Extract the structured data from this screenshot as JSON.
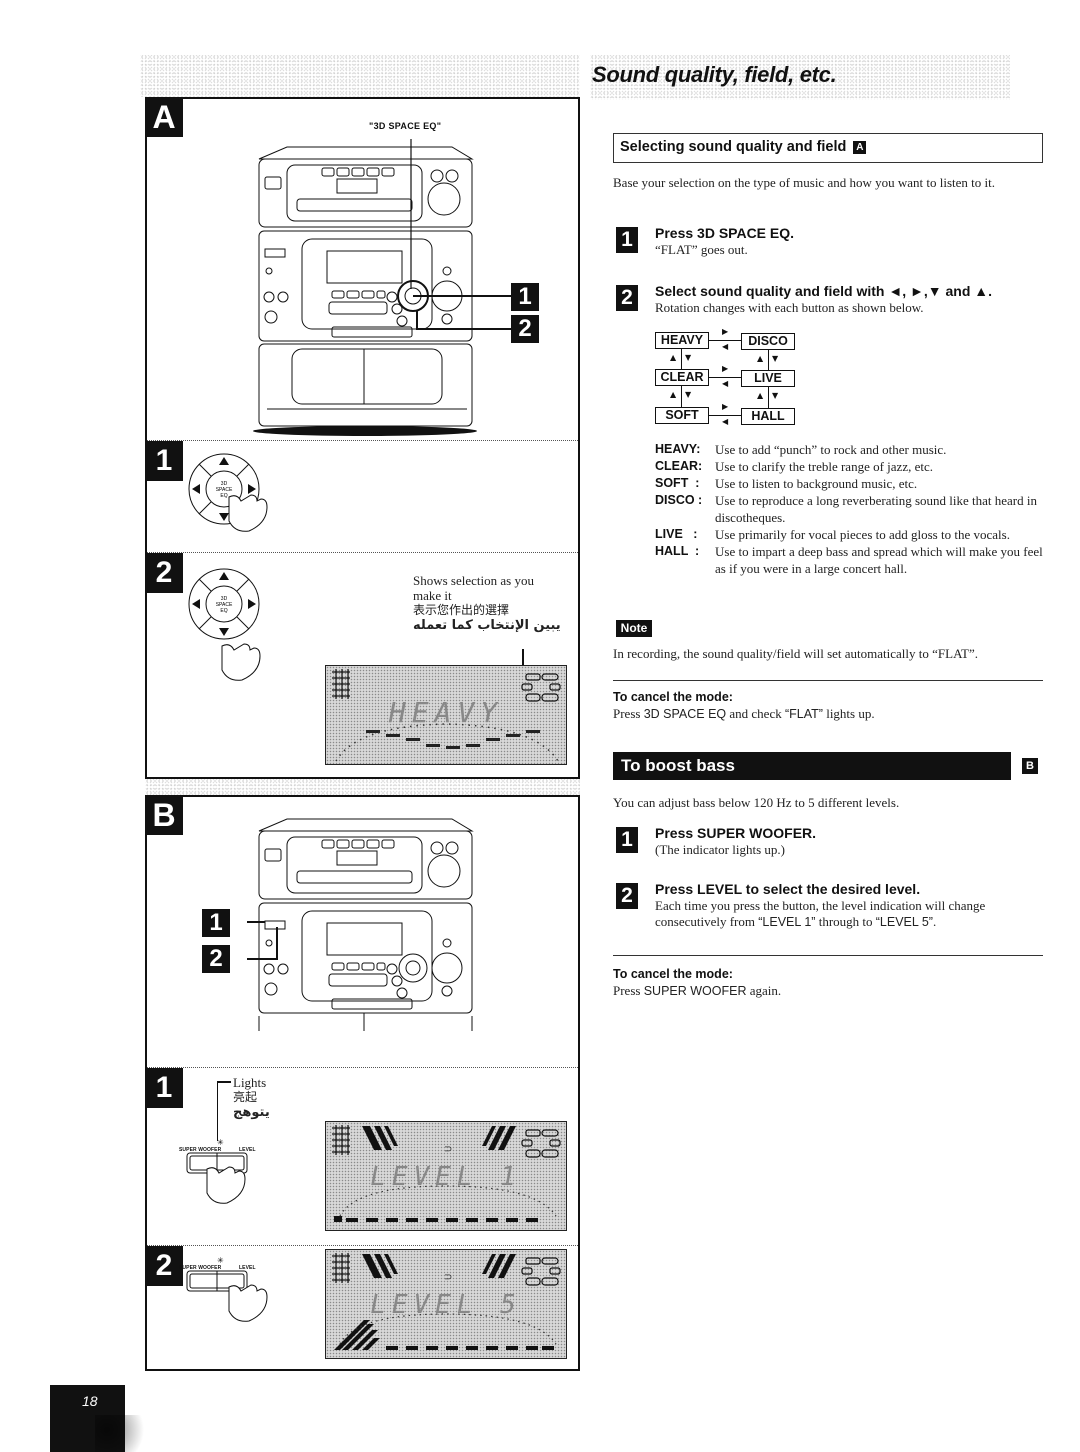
{
  "page": {
    "title": "Sound quality, field, etc.",
    "page_number": "18"
  },
  "figure_a": {
    "letter": "A",
    "callout_label": "\"3D SPACE EQ\"",
    "callout_steps": [
      "1",
      "2"
    ],
    "step1": {
      "number": "1",
      "button_label": [
        "3D",
        "SPACE",
        "EQ"
      ]
    },
    "step2": {
      "number": "2",
      "button_label": [
        "3D",
        "SPACE",
        "EQ"
      ],
      "annotation_en_line1": "Shows selection as you",
      "annotation_en_line2": "make it",
      "annotation_zh": "表示您作出的選擇",
      "annotation_ar": "يبين الإنتخاب كما تعمله",
      "display_text": "HEAVY"
    }
  },
  "figure_b": {
    "letter": "B",
    "callout_steps": [
      "1",
      "2"
    ],
    "step1": {
      "number": "1",
      "annotation_en": "Lights",
      "annotation_zh": "亮起",
      "annotation_ar": "يتوهج",
      "button_label_left": "SUPER WOOFER",
      "button_label_right": "LEVEL",
      "display_text": "LEVEL 1"
    },
    "step2": {
      "number": "2",
      "button_label_left": "SUPER WOOFER",
      "button_label_right": "LEVEL",
      "display_text": "LEVEL 5"
    }
  },
  "section_select": {
    "heading": "Selecting sound quality and field",
    "ref": "A",
    "intro": "Base your selection on the type of music and how you want to listen to it.",
    "steps": [
      {
        "number": "1",
        "head": "Press 3D SPACE EQ.",
        "desc": "“FLAT” goes out."
      },
      {
        "number": "2",
        "head": "Select sound quality and field with ◄, ►,▼ and ▲.",
        "desc": "Rotation changes with each button as shown below."
      }
    ],
    "modes_diagram": {
      "left": [
        "HEAVY",
        "CLEAR",
        "SOFT"
      ],
      "right": [
        "DISCO",
        "LIVE",
        "HALL"
      ]
    },
    "definitions": [
      {
        "term": "HEAVY:",
        "desc": "Use to add “punch” to rock and other music."
      },
      {
        "term": "CLEAR:",
        "desc": "Use to clarify the treble range of jazz, etc."
      },
      {
        "term": "SOFT  :",
        "desc": "Use to listen to background music, etc."
      },
      {
        "term": "DISCO :",
        "desc": "Use to reproduce a long reverberating sound like that heard in discotheques."
      },
      {
        "term": "LIVE   :",
        "desc": "Use primarily for vocal pieces to add gloss to the vocals."
      },
      {
        "term": "HALL  :",
        "desc": "Use to impart a deep bass and spread which will make you feel as if you were in a large concert hall."
      }
    ],
    "note_label": "Note",
    "note_text": "In recording, the sound quality/field will set automatically to “FLAT”.",
    "cancel_head": "To cancel the mode:",
    "cancel_text_pre": "Press ",
    "cancel_text_key": "3D SPACE EQ",
    "cancel_text_mid": " and check ",
    "cancel_text_flat": "“FLAT”",
    "cancel_text_post": " lights up."
  },
  "section_bass": {
    "heading": "To boost bass",
    "ref": "B",
    "intro": "You can adjust bass below 120 Hz to 5 different levels.",
    "steps": [
      {
        "number": "1",
        "head": "Press SUPER WOOFER.",
        "desc": "(The indicator lights up.)"
      },
      {
        "number": "2",
        "head": "Press LEVEL to select the desired level.",
        "desc_pre": "Each time you press the button, the level indication will change consecutively from ",
        "level_from": "“LEVEL 1”",
        "desc_mid": " through to ",
        "level_to": "“LEVEL 5”",
        "desc_post": "."
      }
    ],
    "cancel_head": "To cancel the mode:",
    "cancel_text_pre": "Press ",
    "cancel_text_key": "SUPER WOOFER",
    "cancel_text_post": " again."
  }
}
